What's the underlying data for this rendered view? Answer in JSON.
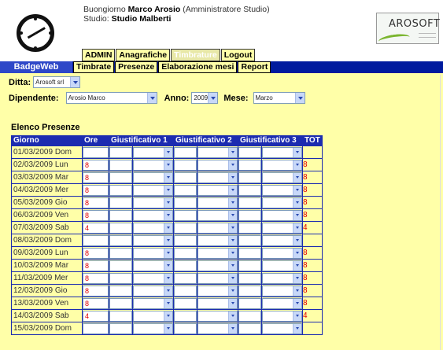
{
  "header": {
    "greeting": "Buongiorno",
    "user_name": "Marco Arosio",
    "role": "(Amministratore Studio)",
    "studio_label": "Studio:",
    "studio_name": "Studio Malberti",
    "logo_text": "AROSOFT",
    "logo_icon": "arosoft-logo",
    "clock_icon": "clock-icon"
  },
  "top_tabs": [
    {
      "label": "ADMIN",
      "active": false
    },
    {
      "label": "Anagrafiche",
      "active": false
    },
    {
      "label": "Timbrature",
      "active": true
    },
    {
      "label": "Logout",
      "active": false
    }
  ],
  "nav": {
    "brand": "BadgeWeb",
    "tabs": [
      "Timbrate",
      "Presenze",
      "Elaborazione mesi",
      "Report"
    ]
  },
  "filters": {
    "ditta_label": "Ditta:",
    "ditta_value": "Arosoft srl",
    "dipendente_label": "Dipendente:",
    "dipendente_value": "Arosio Marco",
    "anno_label": "Anno:",
    "anno_value": "2009",
    "mese_label": "Mese:",
    "mese_value": "Marzo"
  },
  "section_title": "Elenco Presenze",
  "table": {
    "headers": [
      "Giorno",
      "Ore",
      "Giustificativo 1",
      "Giustificativo 2",
      "Giustificativo 3",
      "TOT"
    ],
    "rows": [
      {
        "giorno": "01/03/2009 Dom",
        "ore": "",
        "tot": ""
      },
      {
        "giorno": "02/03/2009 Lun",
        "ore": "8",
        "tot": "8"
      },
      {
        "giorno": "03/03/2009 Mar",
        "ore": "8",
        "tot": "8"
      },
      {
        "giorno": "04/03/2009 Mer",
        "ore": "8",
        "tot": "8"
      },
      {
        "giorno": "05/03/2009 Gio",
        "ore": "8",
        "tot": "8"
      },
      {
        "giorno": "06/03/2009 Ven",
        "ore": "8",
        "tot": "8"
      },
      {
        "giorno": "07/03/2009 Sab",
        "ore": "4",
        "tot": "4"
      },
      {
        "giorno": "08/03/2009 Dom",
        "ore": "",
        "tot": ""
      },
      {
        "giorno": "09/03/2009 Lun",
        "ore": "8",
        "tot": "8"
      },
      {
        "giorno": "10/03/2009 Mar",
        "ore": "8",
        "tot": "8"
      },
      {
        "giorno": "11/03/2009 Mer",
        "ore": "8",
        "tot": "8"
      },
      {
        "giorno": "12/03/2009 Gio",
        "ore": "8",
        "tot": "8"
      },
      {
        "giorno": "13/03/2009 Ven",
        "ore": "8",
        "tot": "8"
      },
      {
        "giorno": "14/03/2009 Sab",
        "ore": "4",
        "tot": "4"
      },
      {
        "giorno": "15/03/2009 Dom",
        "ore": "",
        "tot": ""
      }
    ]
  },
  "colors": {
    "background": "#ffffa8",
    "nav_bar": "#001a9e",
    "table_header": "#1c2cb0",
    "hours_text": "#e00000"
  }
}
